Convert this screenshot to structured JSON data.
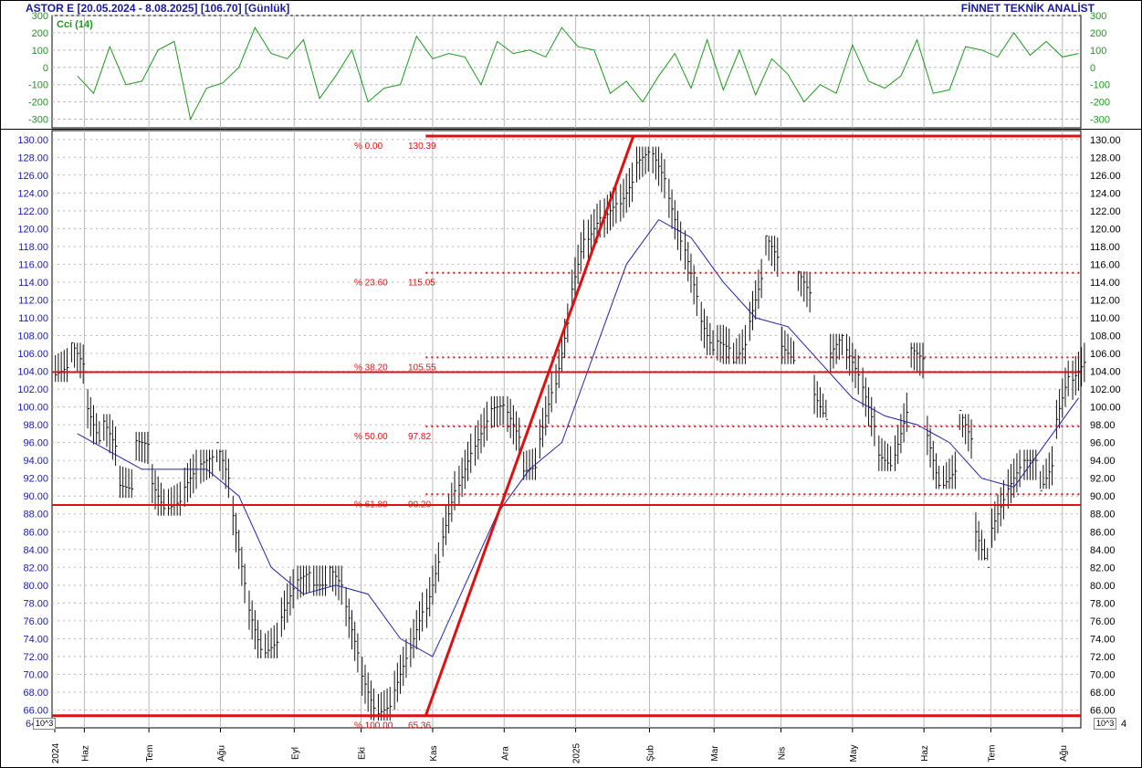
{
  "header": {
    "left": "ASTOR E  [20.05.2024 - 8.08.2025]  [106.70]  [Günlük]",
    "right": "FİNNET TEKNİK ANALİST"
  },
  "indicator": {
    "label": "Cci (14)",
    "ticks": [
      -300,
      -200,
      -100,
      0,
      100,
      200,
      300
    ],
    "color": "#1a9a1a"
  },
  "units": {
    "left": "10^3",
    "right": "10^3"
  },
  "x_labels": [
    "2024",
    "Haz",
    "Tem",
    "Ağu",
    "Eyl",
    "Eki",
    "Kas",
    "Ara",
    "2025",
    "Şub",
    "Mar",
    "Nis",
    "May",
    "Haz",
    "Tem",
    "Ağu"
  ],
  "chart_data": [
    {
      "type": "line",
      "name": "Cci (14)",
      "ylim": [
        -350,
        300
      ],
      "x": [
        "2024-05-31",
        "2024-06-07",
        "2024-06-14",
        "2024-06-21",
        "2024-06-28",
        "2024-07-05",
        "2024-07-12",
        "2024-07-19",
        "2024-07-26",
        "2024-08-02",
        "2024-08-09",
        "2024-08-16",
        "2024-08-23",
        "2024-08-30",
        "2024-09-06",
        "2024-09-13",
        "2024-09-20",
        "2024-09-27",
        "2024-10-04",
        "2024-10-11",
        "2024-10-18",
        "2024-10-25",
        "2024-11-01",
        "2024-11-08",
        "2024-11-15",
        "2024-11-22",
        "2024-11-29",
        "2024-12-06",
        "2024-12-13",
        "2024-12-20",
        "2024-12-27",
        "2025-01-03",
        "2025-01-10",
        "2025-01-17",
        "2025-01-24",
        "2025-01-31",
        "2025-02-07",
        "2025-02-14",
        "2025-02-21",
        "2025-02-28",
        "2025-03-07",
        "2025-03-14",
        "2025-03-21",
        "2025-03-28",
        "2025-04-04",
        "2025-04-11",
        "2025-04-18",
        "2025-04-25",
        "2025-05-02",
        "2025-05-09",
        "2025-05-16",
        "2025-05-23",
        "2025-05-30",
        "2025-06-06",
        "2025-06-13",
        "2025-06-20",
        "2025-06-27",
        "2025-07-04",
        "2025-07-11",
        "2025-07-18",
        "2025-07-25",
        "2025-08-01",
        "2025-08-08"
      ],
      "values": [
        -50,
        -150,
        120,
        -100,
        -80,
        100,
        150,
        -300,
        -120,
        -90,
        0,
        230,
        80,
        50,
        160,
        -180,
        -50,
        100,
        -200,
        -120,
        -100,
        180,
        50,
        80,
        60,
        -100,
        150,
        80,
        100,
        60,
        230,
        120,
        100,
        -150,
        -80,
        -200,
        -50,
        80,
        -120,
        160,
        -130,
        100,
        -160,
        50,
        -40,
        -200,
        -100,
        -150,
        130,
        -80,
        -120,
        -50,
        160,
        -150,
        -130,
        120,
        100,
        60,
        200,
        70,
        150,
        60,
        80
      ]
    },
    {
      "type": "line",
      "name": "",
      "ylim": [
        64,
        131
      ],
      "x": [
        "2024-05-24",
        "2024-05-31",
        "2024-06-07",
        "2024-06-14",
        "2024-06-21",
        "2024-06-28",
        "2024-07-05",
        "2024-07-12",
        "2024-07-19",
        "2024-07-26",
        "2024-08-02",
        "2024-08-09",
        "2024-08-16",
        "2024-08-23",
        "2024-08-30",
        "2024-09-06",
        "2024-09-13",
        "2024-09-20",
        "2024-09-27",
        "2024-10-04",
        "2024-10-11",
        "2024-10-18",
        "2024-10-25",
        "2024-11-01",
        "2024-11-08",
        "2024-11-15",
        "2024-11-22",
        "2024-11-29",
        "2024-12-06",
        "2024-12-13",
        "2024-12-20",
        "2024-12-27",
        "2025-01-03",
        "2025-01-10",
        "2025-01-17",
        "2025-01-24",
        "2025-01-31",
        "2025-02-07",
        "2025-02-14",
        "2025-02-21",
        "2025-02-28",
        "2025-03-07",
        "2025-03-14",
        "2025-03-21",
        "2025-03-28",
        "2025-04-04",
        "2025-04-11",
        "2025-04-18",
        "2025-04-25",
        "2025-05-02",
        "2025-05-09",
        "2025-05-16",
        "2025-05-23",
        "2025-05-30",
        "2025-06-06",
        "2025-06-13",
        "2025-06-20",
        "2025-06-27",
        "2025-07-04",
        "2025-07-11",
        "2025-07-18",
        "2025-07-25",
        "2025-08-01",
        "2025-08-08"
      ],
      "values": [
        104,
        106,
        98,
        97,
        91,
        96,
        90,
        89,
        92,
        94,
        94,
        84,
        75,
        73,
        78,
        81,
        80,
        81,
        75,
        68,
        66,
        70,
        75,
        80,
        88,
        93,
        97,
        100,
        98,
        93,
        99,
        106,
        116,
        120,
        122,
        124,
        128,
        127,
        121,
        115,
        108,
        107,
        106,
        112,
        118,
        106,
        114,
        100,
        107,
        105,
        100,
        94,
        97,
        106,
        94,
        92,
        98,
        84,
        88,
        92,
        94,
        92,
        101,
        104,
        106
      ]
    },
    {
      "type": "line",
      "name": "",
      "ylim": [
        64,
        131
      ],
      "x": [
        "2024-05-31",
        "2024-06-14",
        "2024-06-28",
        "2024-07-12",
        "2024-07-26",
        "2024-08-09",
        "2024-08-23",
        "2024-09-06",
        "2024-09-20",
        "2024-10-04",
        "2024-10-18",
        "2024-11-01",
        "2024-11-15",
        "2024-11-29",
        "2024-12-13",
        "2024-12-27",
        "2025-01-10",
        "2025-01-24",
        "2025-02-07",
        "2025-02-21",
        "2025-03-07",
        "2025-03-21",
        "2025-04-04",
        "2025-04-18",
        "2025-05-02",
        "2025-05-16",
        "2025-05-30",
        "2025-06-13",
        "2025-06-27",
        "2025-07-11",
        "2025-07-25",
        "2025-08-08"
      ],
      "values": [
        97,
        95,
        93,
        93,
        93,
        90,
        82,
        79,
        80,
        79,
        74,
        72,
        80,
        88,
        93,
        96,
        106,
        116,
        121,
        119,
        114,
        110,
        109,
        105,
        101,
        99,
        98,
        96,
        92,
        91,
        96,
        101
      ]
    }
  ],
  "price_axis": {
    "ticks": [
      66,
      68,
      70,
      72,
      74,
      76,
      78,
      80,
      82,
      84,
      86,
      88,
      90,
      92,
      94,
      96,
      98,
      100,
      102,
      104,
      106,
      108,
      110,
      112,
      114,
      116,
      118,
      120,
      122,
      124,
      126,
      128,
      130
    ],
    "bottom_tick_left": "64",
    "bottom_tick_right": "4"
  },
  "fibonacci": {
    "levels": [
      {
        "pct": "% 0.00",
        "value": "130.39",
        "v": 130.39,
        "style": "solid"
      },
      {
        "pct": "% 23.60",
        "value": "115.05",
        "v": 115.05,
        "style": "dotted"
      },
      {
        "pct": "% 38.20",
        "value": "105.55",
        "v": 105.55,
        "style": "dotted"
      },
      {
        "pct": "% 50.00",
        "value": "97.82",
        "v": 97.82,
        "style": "dotted"
      },
      {
        "pct": "% 61.80",
        "value": "90.20",
        "v": 90.2,
        "style": "dotted"
      },
      {
        "pct": "% 100.00",
        "value": "65.36",
        "v": 65.36,
        "style": "solid"
      }
    ],
    "horizontals": [
      103.9,
      89.0
    ],
    "trend_from": {
      "x": "2024-10-29",
      "y": 65.36
    },
    "trend_to": {
      "x": "2025-01-27",
      "y": 130.39
    }
  },
  "colors": {
    "frame": "#000000",
    "axis_text": "#1a1ab0",
    "price": "#111111",
    "ma": "#2222aa",
    "fib": "#dd1111",
    "grid": "#b8b8b8"
  }
}
